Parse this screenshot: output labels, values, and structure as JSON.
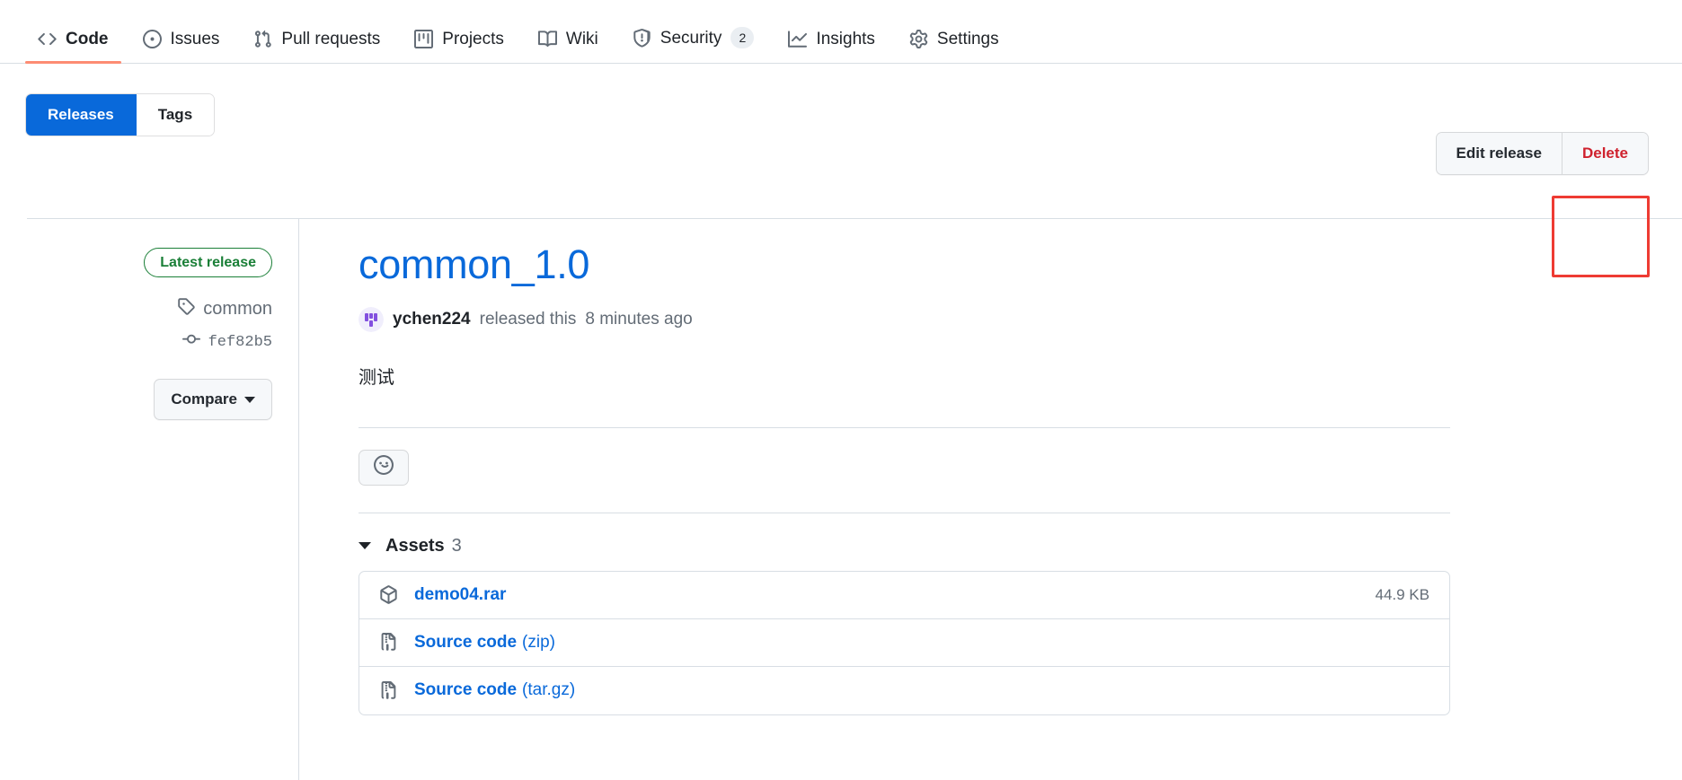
{
  "repo_nav": {
    "items": [
      {
        "label": "Code",
        "icon": "code-icon",
        "active": true,
        "count": null
      },
      {
        "label": "Issues",
        "icon": "issue-opened-icon",
        "active": false,
        "count": null
      },
      {
        "label": "Pull requests",
        "icon": "git-pull-request-icon",
        "active": false,
        "count": null
      },
      {
        "label": "Projects",
        "icon": "project-icon",
        "active": false,
        "count": null
      },
      {
        "label": "Wiki",
        "icon": "book-icon",
        "active": false,
        "count": null
      },
      {
        "label": "Security",
        "icon": "shield-icon",
        "active": false,
        "count": "2"
      },
      {
        "label": "Insights",
        "icon": "graph-icon",
        "active": false,
        "count": null
      },
      {
        "label": "Settings",
        "icon": "gear-icon",
        "active": false,
        "count": null
      }
    ],
    "active_underline_color": "#fd8c73"
  },
  "subheader": {
    "segmented": {
      "releases_label": "Releases",
      "tags_label": "Tags",
      "selected": "Releases",
      "selected_bg": "#0969da"
    },
    "actions": {
      "edit_label": "Edit release",
      "delete_label": "Delete",
      "delete_color": "#cf222e"
    },
    "annotation": {
      "target": "Delete",
      "box_color": "#ee3b33"
    }
  },
  "sidebar": {
    "latest_badge": "Latest release",
    "latest_badge_color": "#1a7f37",
    "tag_name": "common",
    "tag_icon": "tag-icon",
    "commit_sha": "fef82b5",
    "commit_icon": "git-commit-icon",
    "compare_label": "Compare"
  },
  "release": {
    "title": "common_1.0",
    "title_color": "#0969da",
    "author": "ychen224",
    "byline_action": "released this",
    "released_ago": "8 minutes ago",
    "body": "测试",
    "reaction_icon": "smiley-icon"
  },
  "assets": {
    "heading_label": "Assets",
    "count": "3",
    "rows": [
      {
        "icon": "package-icon",
        "name": "demo04.rar",
        "suffix": "",
        "size": "44.9 KB"
      },
      {
        "icon": "file-zip-icon",
        "name": "Source code",
        "suffix": "(zip)",
        "size": ""
      },
      {
        "icon": "file-zip-icon",
        "name": "Source code",
        "suffix": "(tar.gz)",
        "size": ""
      }
    ]
  }
}
